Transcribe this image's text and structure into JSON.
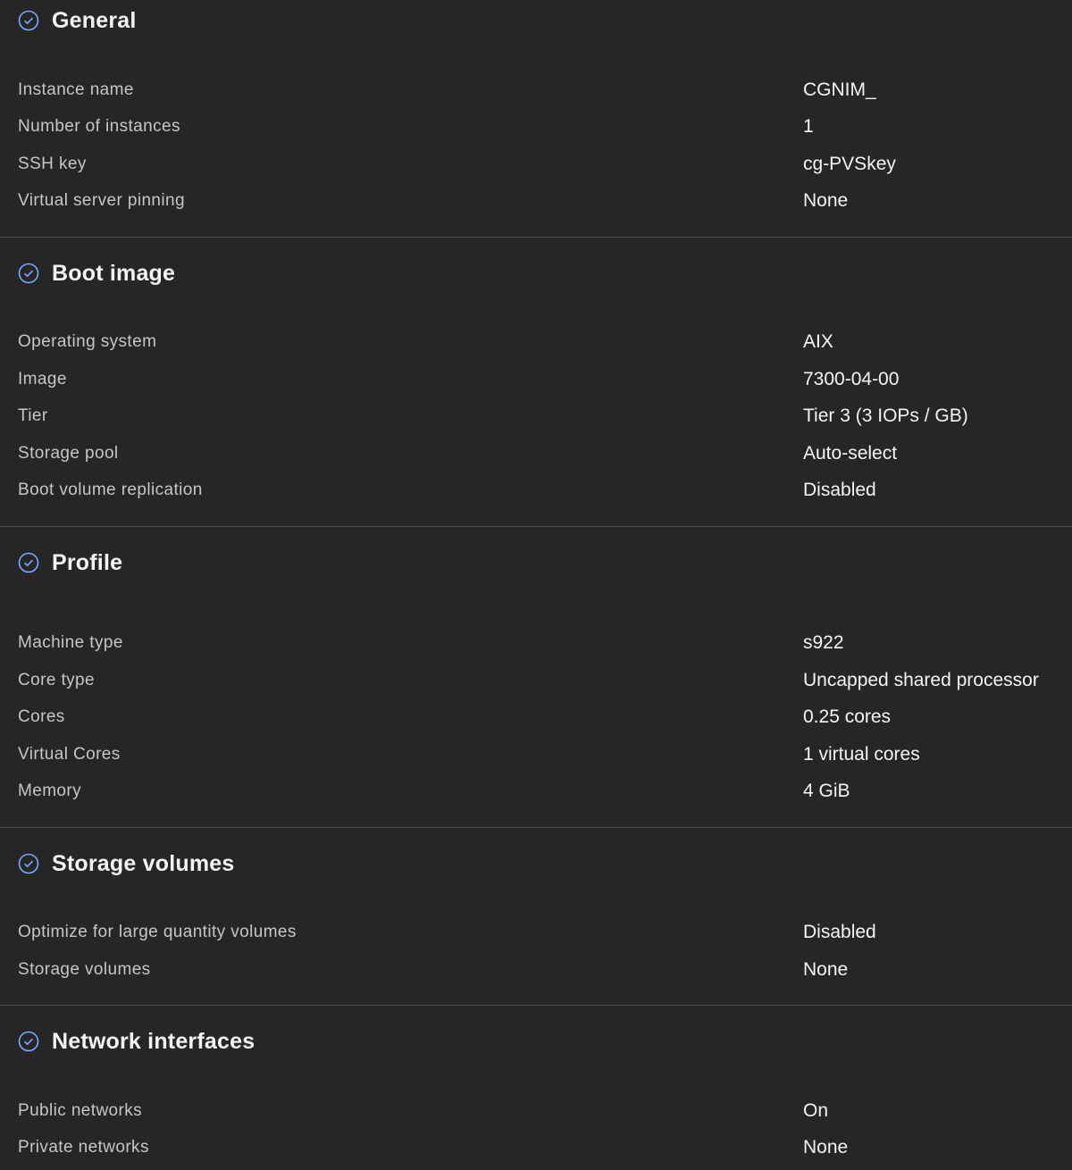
{
  "icon_color": "#78a9ff",
  "sections": [
    {
      "title": "General",
      "icon": "checkmark-outline-icon",
      "rows": [
        {
          "label": "Instance name",
          "value": "CGNIM_"
        },
        {
          "label": "Number of instances",
          "value": "1"
        },
        {
          "label": "SSH key",
          "value": "cg-PVSkey"
        },
        {
          "label": "Virtual server pinning",
          "value": "None"
        }
      ]
    },
    {
      "title": "Boot image",
      "icon": "checkmark-outline-icon",
      "rows": [
        {
          "label": "Operating system",
          "value": "AIX"
        },
        {
          "label": "Image",
          "value": "7300-04-00"
        },
        {
          "label": "Tier",
          "value": "Tier 3 (3 IOPs / GB)"
        },
        {
          "label": "Storage pool",
          "value": "Auto-select"
        },
        {
          "label": "Boot volume replication",
          "value": "Disabled"
        }
      ]
    },
    {
      "title": "Profile",
      "icon": "checkmark-outline-icon",
      "rows": [
        {
          "label": "Machine type",
          "value": "s922"
        },
        {
          "label": "Core type",
          "value": "Uncapped shared processor"
        },
        {
          "label": "Cores",
          "value": "0.25 cores"
        },
        {
          "label": "Virtual Cores",
          "value": "1 virtual cores"
        },
        {
          "label": "Memory",
          "value": "4 GiB"
        }
      ]
    },
    {
      "title": "Storage volumes",
      "icon": "checkmark-outline-icon",
      "rows": [
        {
          "label": "Optimize for large quantity volumes",
          "value": "Disabled"
        },
        {
          "label": "Storage volumes",
          "value": "None"
        }
      ]
    },
    {
      "title": "Network interfaces",
      "icon": "checkmark-outline-icon",
      "rows": [
        {
          "label": "Public networks",
          "value": "On"
        },
        {
          "label": "Private networks",
          "value": "None"
        }
      ]
    }
  ]
}
